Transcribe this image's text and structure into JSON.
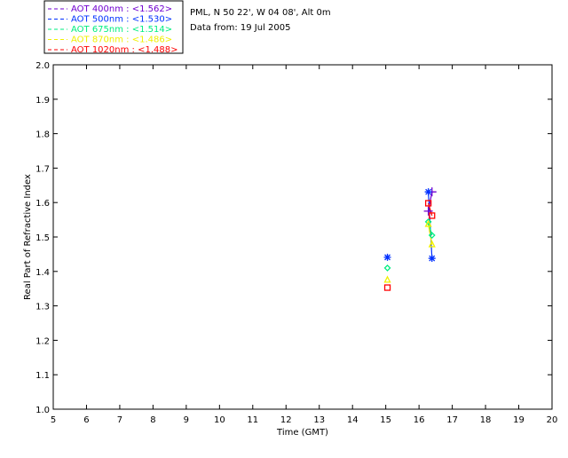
{
  "chart_data": {
    "type": "scatter",
    "title_lines": [
      "PML, N 50 22', W 04 08', Alt 0m",
      "Data from: 19 Jul 2005"
    ],
    "xlabel": "Time (GMT)",
    "ylabel": "Real Part of Refractive Index",
    "xlim": [
      5,
      20
    ],
    "ylim": [
      1.0,
      2.0
    ],
    "xticks": [
      "5",
      "6",
      "7",
      "8",
      "9",
      "10",
      "11",
      "12",
      "13",
      "14",
      "15",
      "16",
      "17",
      "18",
      "19",
      "20"
    ],
    "yticks": [
      "1.0",
      "1.1",
      "1.2",
      "1.3",
      "1.4",
      "1.5",
      "1.6",
      "1.7",
      "1.8",
      "1.9",
      "2.0"
    ],
    "grid": false,
    "legend_position": "top-left",
    "series": [
      {
        "name": "AOT  400nm",
        "mean": "<1.562>",
        "color": "#7000d0",
        "marker": "plus",
        "x": [
          16.28,
          16.39
        ],
        "y": [
          1.575,
          1.631
        ]
      },
      {
        "name": "AOT  500nm",
        "mean": "<1.530>",
        "color": "#0030ff",
        "marker": "asterisk",
        "x": [
          15.05,
          16.28,
          16.39
        ],
        "y": [
          1.441,
          1.631,
          1.438
        ]
      },
      {
        "name": "AOT  675nm",
        "mean": "<1.514>",
        "color": "#00ee80",
        "marker": "diamond",
        "x": [
          15.05,
          16.28,
          16.39
        ],
        "y": [
          1.41,
          1.544,
          1.505
        ]
      },
      {
        "name": "AOT  870nm",
        "mean": "<1.486>",
        "color": "#f0f000",
        "marker": "triangle",
        "x": [
          15.05,
          16.28,
          16.39
        ],
        "y": [
          1.374,
          1.536,
          1.477
        ]
      },
      {
        "name": "AOT 1020nm",
        "mean": "<1.488>",
        "color": "#ff0000",
        "marker": "square",
        "x": [
          15.05,
          16.28,
          16.39
        ],
        "y": [
          1.353,
          1.598,
          1.562
        ]
      }
    ]
  }
}
